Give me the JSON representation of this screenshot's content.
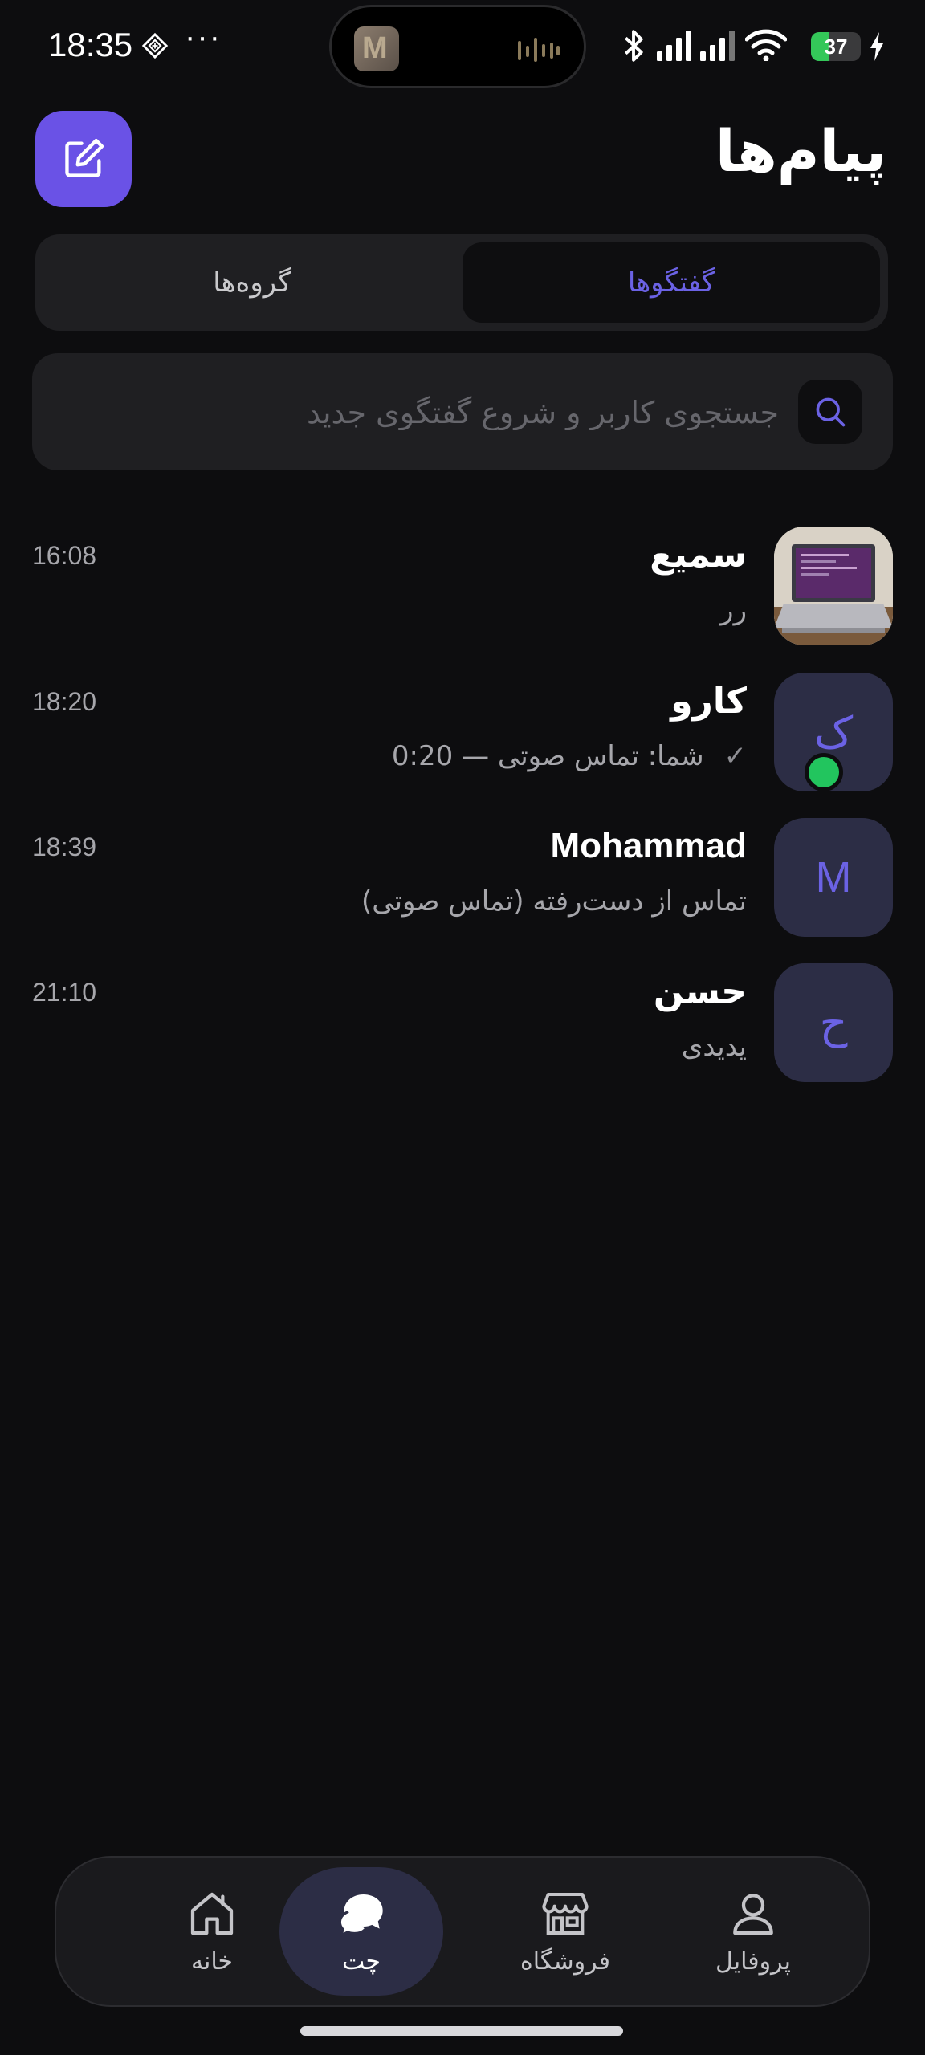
{
  "status_bar": {
    "time": "18:35",
    "dots": "···",
    "battery": "37",
    "battery_level": 0.37,
    "icons": [
      "diamond-icon",
      "bluetooth-icon",
      "signal-icon",
      "signal-icon",
      "wifi-icon",
      "battery-icon",
      "charging-icon"
    ]
  },
  "header": {
    "title": "پیام‌ها",
    "compose_icon": "compose-icon"
  },
  "tabs": {
    "active_label": "گفتگوها",
    "inactive_label": "گروه‌ها"
  },
  "search": {
    "placeholder": "جستجوی کاربر و شروع گفتگوی جدید",
    "icon": "search-icon"
  },
  "conversations": [
    {
      "name": "سمیع",
      "preview": "رر",
      "time": "16:08",
      "avatar_type": "photo",
      "online": false
    },
    {
      "name": "کارو",
      "preview": "شما: تماس صوتی — 0:20",
      "preview_check": "✓",
      "time": "18:20",
      "avatar_letter": "ک",
      "online": true
    },
    {
      "name": "Mohammad",
      "preview": "تماس از دست‌رفته (تماس صوتی)",
      "time": "18:39",
      "avatar_letter": "M",
      "online": false
    },
    {
      "name": "حسن",
      "preview": "یدیدی",
      "time": "21:10",
      "avatar_letter": "ح",
      "online": false
    }
  ],
  "bottom_nav": {
    "items": [
      {
        "label": "خانه",
        "icon": "home-icon",
        "active": false
      },
      {
        "label": "چت",
        "icon": "chat-icon",
        "active": true
      },
      {
        "label": "فروشگاه",
        "icon": "store-icon",
        "active": false
      },
      {
        "label": "پروفایل",
        "icon": "profile-icon",
        "active": false
      }
    ]
  },
  "colors": {
    "background": "#0d0d0f",
    "accent": "#6a52e6",
    "accent_text": "#6b62e4",
    "surface": "#1f1f22",
    "online": "#22c55e"
  }
}
